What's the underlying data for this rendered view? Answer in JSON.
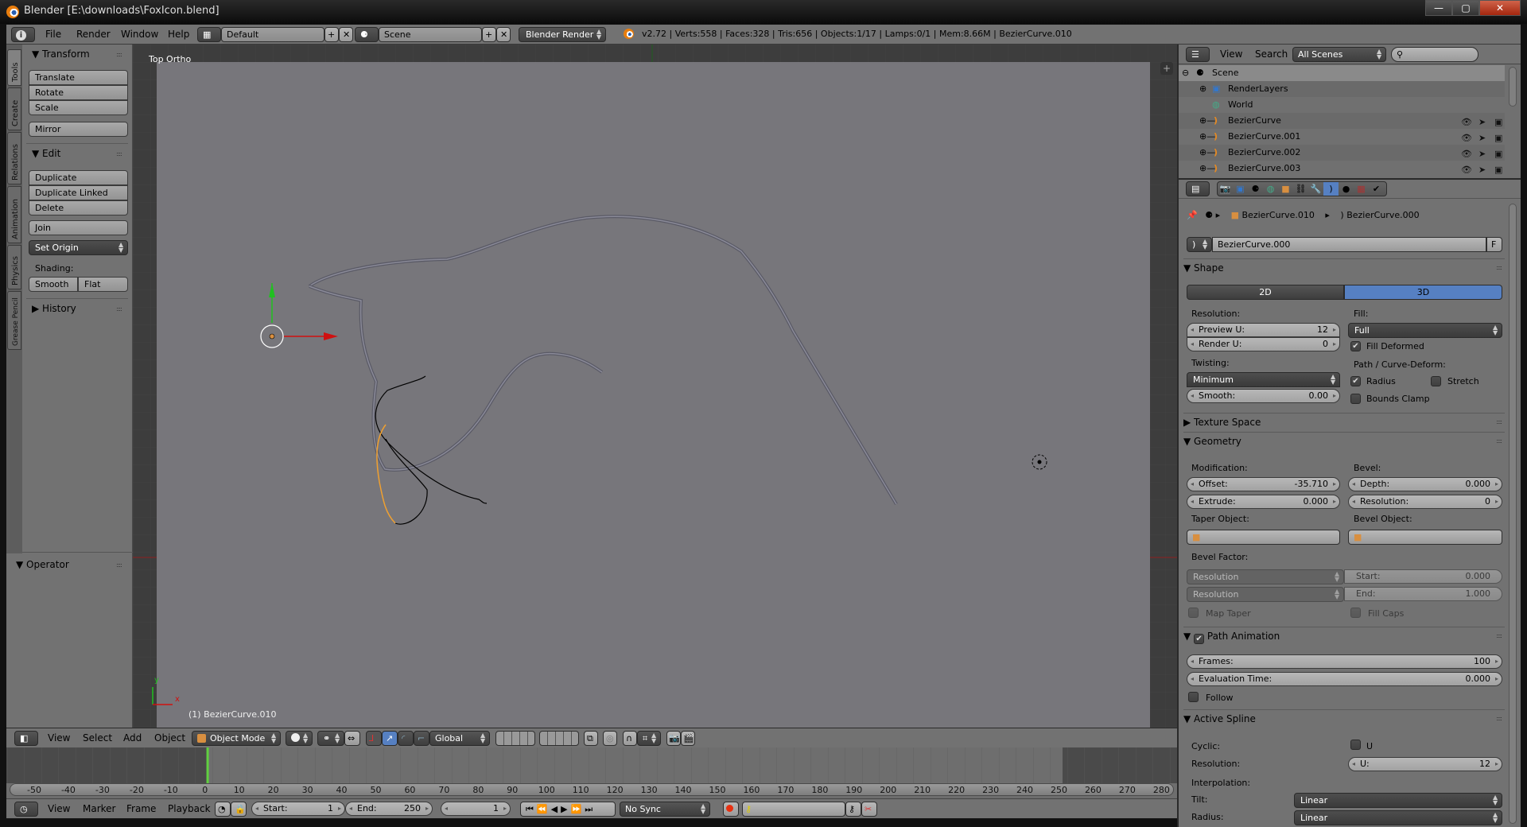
{
  "window": {
    "title": "Blender [E:\\downloads\\FoxIcon.blend]",
    "controls": {
      "minimize": "—",
      "maximize": "▢",
      "close": "✕"
    }
  },
  "info_header": {
    "editor_icon": "info-icon",
    "menus": [
      "File",
      "Render",
      "Window",
      "Help"
    ],
    "screen_layout": "Default",
    "scene": "Scene",
    "render_engine": "Blender Render",
    "stats": "v2.72 | Verts:558 | Faces:328 | Tris:656 | Objects:1/17 | Lamps:0/1 | Mem:8.66M | BezierCurve.010"
  },
  "tool_shelf": {
    "tabs": [
      "Tools",
      "Create",
      "Relations",
      "Animation",
      "Physics",
      "Grease Pencil"
    ],
    "active_tab": "Tools",
    "transform": {
      "title": "Transform",
      "buttons": [
        "Translate",
        "Rotate",
        "Scale"
      ],
      "mirror": "Mirror"
    },
    "edit": {
      "title": "Edit",
      "buttons": [
        "Duplicate",
        "Duplicate Linked",
        "Delete"
      ],
      "join": "Join",
      "set_origin": "Set Origin",
      "shading_label": "Shading:",
      "smooth": "Smooth",
      "flat": "Flat"
    },
    "history": {
      "title": "History"
    },
    "operator": {
      "title": "Operator"
    }
  },
  "viewport": {
    "view_name": "Top Ortho",
    "active_object_label": "(1) BezierCurve.010",
    "axis_x": "x",
    "axis_y": "y"
  },
  "view3d_header": {
    "menus": [
      "View",
      "Select",
      "Add",
      "Object"
    ],
    "mode": "Object Mode",
    "orientation": "Global"
  },
  "timeline": {
    "ruler_ticks": [
      "-50",
      "-40",
      "-30",
      "-20",
      "-10",
      "0",
      "10",
      "20",
      "30",
      "40",
      "50",
      "60",
      "70",
      "80",
      "90",
      "100",
      "110",
      "120",
      "130",
      "140",
      "150",
      "160",
      "170",
      "180",
      "190",
      "200",
      "210",
      "220",
      "230",
      "240",
      "250",
      "260",
      "270",
      "280"
    ],
    "current_frame": 1,
    "menus": [
      "View",
      "Marker",
      "Frame",
      "Playback"
    ],
    "start_label": "Start:",
    "start": "1",
    "end_label": "End:",
    "end": "250",
    "frame": "1",
    "sync": "No Sync"
  },
  "outliner": {
    "menus": [
      "View",
      "Search"
    ],
    "display_mode": "All Scenes",
    "search_placeholder": "",
    "items": [
      {
        "name": "Scene",
        "type": "scene"
      },
      {
        "name": "RenderLayers",
        "type": "renderlayers"
      },
      {
        "name": "World",
        "type": "world"
      },
      {
        "name": "BezierCurve",
        "type": "curve"
      },
      {
        "name": "BezierCurve.001",
        "type": "curve"
      },
      {
        "name": "BezierCurve.002",
        "type": "curve"
      },
      {
        "name": "BezierCurve.003",
        "type": "curve"
      }
    ]
  },
  "properties": {
    "breadcrumb": {
      "object": "BezierCurve.010",
      "data": "BezierCurve.000"
    },
    "datablock_name": "BezierCurve.000",
    "fake_user": "F",
    "shape": {
      "title": "Shape",
      "dim_2d": "2D",
      "dim_3d": "3D",
      "active_dim": "3D",
      "resolution_label": "Resolution:",
      "preview_u_label": "Preview U:",
      "preview_u": "12",
      "render_u_label": "Render U:",
      "render_u": "0",
      "fill_label": "Fill:",
      "fill": "Full",
      "fill_deformed_label": "Fill Deformed",
      "fill_deformed": true,
      "twisting_label": "Twisting:",
      "twisting": "Minimum",
      "smooth_label": "Smooth:",
      "smooth": "0.00",
      "path_deform_label": "Path / Curve-Deform:",
      "radius_label": "Radius",
      "radius": true,
      "stretch_label": "Stretch",
      "stretch": false,
      "bounds_clamp_label": "Bounds Clamp",
      "bounds_clamp": false
    },
    "texture_space": {
      "title": "Texture Space"
    },
    "geometry": {
      "title": "Geometry",
      "modification_label": "Modification:",
      "offset_label": "Offset:",
      "offset": "-35.710",
      "extrude_label": "Extrude:",
      "extrude": "0.000",
      "bevel_label": "Bevel:",
      "depth_label": "Depth:",
      "depth": "0.000",
      "resolution_label": "Resolution:",
      "resolution": "0",
      "taper_object_label": "Taper Object:",
      "bevel_object_label": "Bevel Object:",
      "bevel_factor_label": "Bevel Factor:",
      "bevel_factor_mode_start": "Resolution",
      "bevel_factor_mode_end": "Resolution",
      "start_label": "Start:",
      "start": "0.000",
      "end_label": "End:",
      "end": "1.000",
      "map_taper_label": "Map Taper",
      "fill_caps_label": "Fill Caps"
    },
    "path_animation": {
      "title": "Path Animation",
      "enabled": true,
      "frames_label": "Frames:",
      "frames": "100",
      "eval_time_label": "Evaluation Time:",
      "eval_time": "0.000",
      "follow_label": "Follow",
      "follow": false
    },
    "active_spline": {
      "title": "Active Spline",
      "cyclic_label": "Cyclic:",
      "cyclic_u_label": "U",
      "resolution_label": "Resolution:",
      "u_label": "U:",
      "u": "12",
      "interpolation_label": "Interpolation:",
      "tilt_label": "Tilt:",
      "tilt": "Linear",
      "radius_label": "Radius:",
      "radius": "Linear"
    }
  },
  "colors": {
    "accent_blue": "#5680c2",
    "selected_orange": "#f0a030",
    "axis_x_red": "#d01010",
    "axis_y_green": "#20c020",
    "frame_green": "#60d040"
  }
}
